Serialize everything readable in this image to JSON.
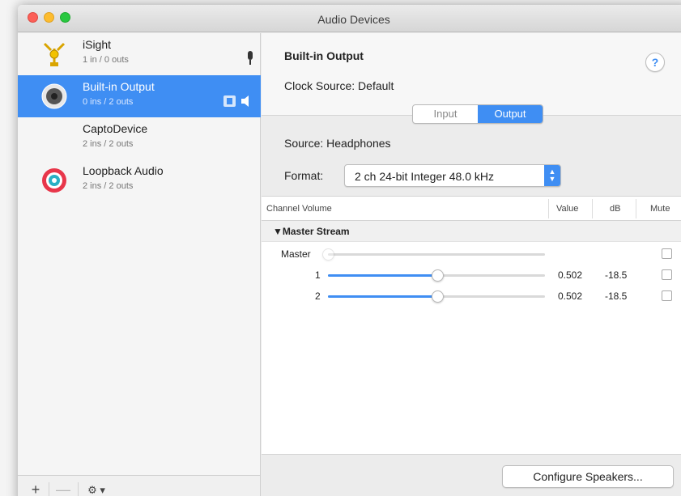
{
  "window": {
    "title": "Audio Devices"
  },
  "sidebar": {
    "devices": [
      {
        "name": "iSight",
        "io": "1 in / 0 outs",
        "icon": "firewire-icon"
      },
      {
        "name": "Built-in Output",
        "io": "0 ins / 2 outs",
        "icon": "speaker-icon"
      },
      {
        "name": "CaptoDevice",
        "io": "2 ins / 2 outs",
        "icon": ""
      },
      {
        "name": "Loopback Audio",
        "io": "2 ins / 2 outs",
        "icon": "loopback-icon"
      }
    ],
    "add_label": "+",
    "remove_label": "—",
    "gear_label": "⚙ ▾"
  },
  "detail": {
    "device_title": "Built-in Output",
    "clock_label": "Clock Source:",
    "clock_value": "Default",
    "help_label": "?",
    "tabs": [
      "Input",
      "Output"
    ],
    "active_tab": "Output",
    "source_label": "Source:",
    "source_value": "Headphones",
    "format_label": "Format:",
    "format_value": "2 ch 24-bit Integer 48.0 kHz"
  },
  "table": {
    "headers": {
      "channel": "Channel Volume",
      "value": "Value",
      "db": "dB",
      "mute": "Mute"
    },
    "group": "▼Master Stream",
    "rows": [
      {
        "label": "Master",
        "value": "",
        "db": "",
        "level": 0.0
      },
      {
        "label": "1",
        "value": "0.502",
        "db": "-18.5",
        "level": 0.502
      },
      {
        "label": "2",
        "value": "0.502",
        "db": "-18.5",
        "level": 0.502
      }
    ]
  },
  "footer": {
    "configure_label": "Configure Speakers..."
  },
  "colors": {
    "accent": "#3f8ef3",
    "loopback": "#e8364a"
  }
}
